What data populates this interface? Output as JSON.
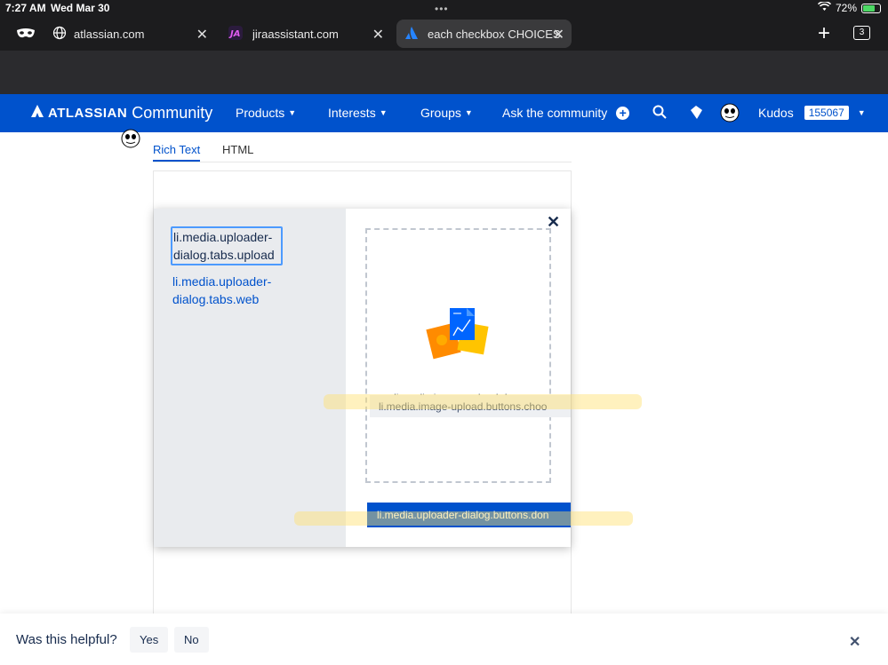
{
  "status_bar": {
    "time": "7:27 AM",
    "date": "Wed Mar 30",
    "battery": "72%",
    "battery_level": 0.72
  },
  "browser": {
    "tabs": [
      {
        "label": "atlassian.com",
        "icon": "globe-icon"
      },
      {
        "label": "jiraassistant.com",
        "icon": "jira-assistant-icon"
      },
      {
        "label": "each checkbox CHOICES pc",
        "icon": "atlassian-icon",
        "active": true
      }
    ],
    "tab_count": "3"
  },
  "nav": {
    "brand": "ATLASSIAN",
    "community": "Community",
    "items": [
      "Products",
      "Interests",
      "Groups",
      "Ask the community"
    ],
    "kudos_label": "Kudos",
    "kudos_count": "155067",
    "accent": "#0052cc"
  },
  "editor": {
    "tabs": [
      "Rich Text",
      "HTML"
    ]
  },
  "dialog": {
    "tab_upload": "li.media.uploader-dialog.tabs.upload",
    "tab_web": "li.media.uploader-dialog.tabs.web",
    "drop_text": "li.media.image-upload.drop",
    "choose_button": "li.media.image-upload.buttons.choo",
    "done_button": "li.media.uploader-dialog.buttons.don"
  },
  "feedback": {
    "question": "Was this helpful?",
    "yes": "Yes",
    "no": "No"
  }
}
